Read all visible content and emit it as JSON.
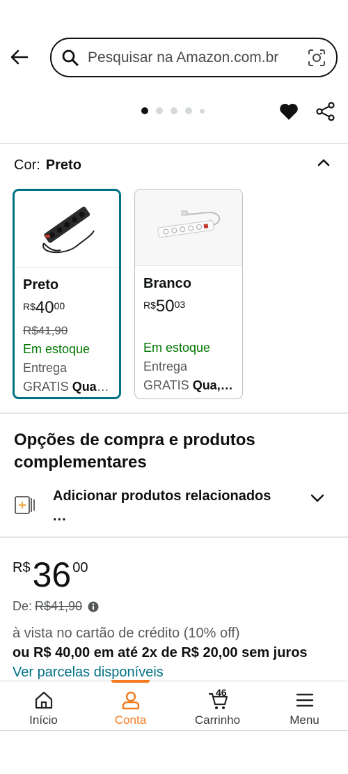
{
  "header": {
    "search_placeholder": "Pesquisar na Amazon.com.br",
    "back_icon": "arrow-left-icon",
    "search_icon": "magnifier-icon",
    "camera_icon": "camera-lens-icon"
  },
  "gallery": {
    "dots": 5,
    "active_dot": 1,
    "heart_icon": "heart-icon",
    "share_icon": "share-icon"
  },
  "color_section": {
    "label": "Cor:",
    "selected": "Preto",
    "options": [
      {
        "name": "Preto",
        "currency": "R$",
        "whole": "40",
        "fraction": "00",
        "old_price": "R$41,90",
        "stock": "Em estoque",
        "delivery_line1": "Entrega",
        "delivery_prefix": "GRATIS",
        "delivery_bold": "Qua,…"
      },
      {
        "name": "Branco",
        "currency": "R$",
        "whole": "50",
        "fraction": "03",
        "old_price": "",
        "stock": "Em estoque",
        "delivery_line1": "Entrega",
        "delivery_prefix": "GRATIS",
        "delivery_bold": "Qua,…"
      }
    ]
  },
  "options_section": {
    "title": "Opções de compra e produtos complementares",
    "related_label": "Adicionar produtos relacionados",
    "related_more": "..."
  },
  "price": {
    "currency": "R$",
    "whole": "36",
    "fraction": "00",
    "de_label": "De:",
    "de_value": "R$41,90",
    "avista": "à vista no cartão de crédito (10% off)",
    "parcel": "ou R$ 40,00 em até 2x de R$ 20,00 sem juros",
    "ver_parcelas": "Ver parcelas disponíveis"
  },
  "nav": {
    "items": [
      {
        "label": "Início",
        "icon": "home-icon"
      },
      {
        "label": "Conta",
        "icon": "account-icon"
      },
      {
        "label": "Carrinho",
        "icon": "cart-icon",
        "count": "46"
      },
      {
        "label": "Menu",
        "icon": "hamburger-icon"
      }
    ],
    "active": "Conta"
  },
  "colors": {
    "teal_selected": "#007185",
    "stock_green": "#007600",
    "nav_accent": "#f47b20",
    "link": "#007185"
  }
}
